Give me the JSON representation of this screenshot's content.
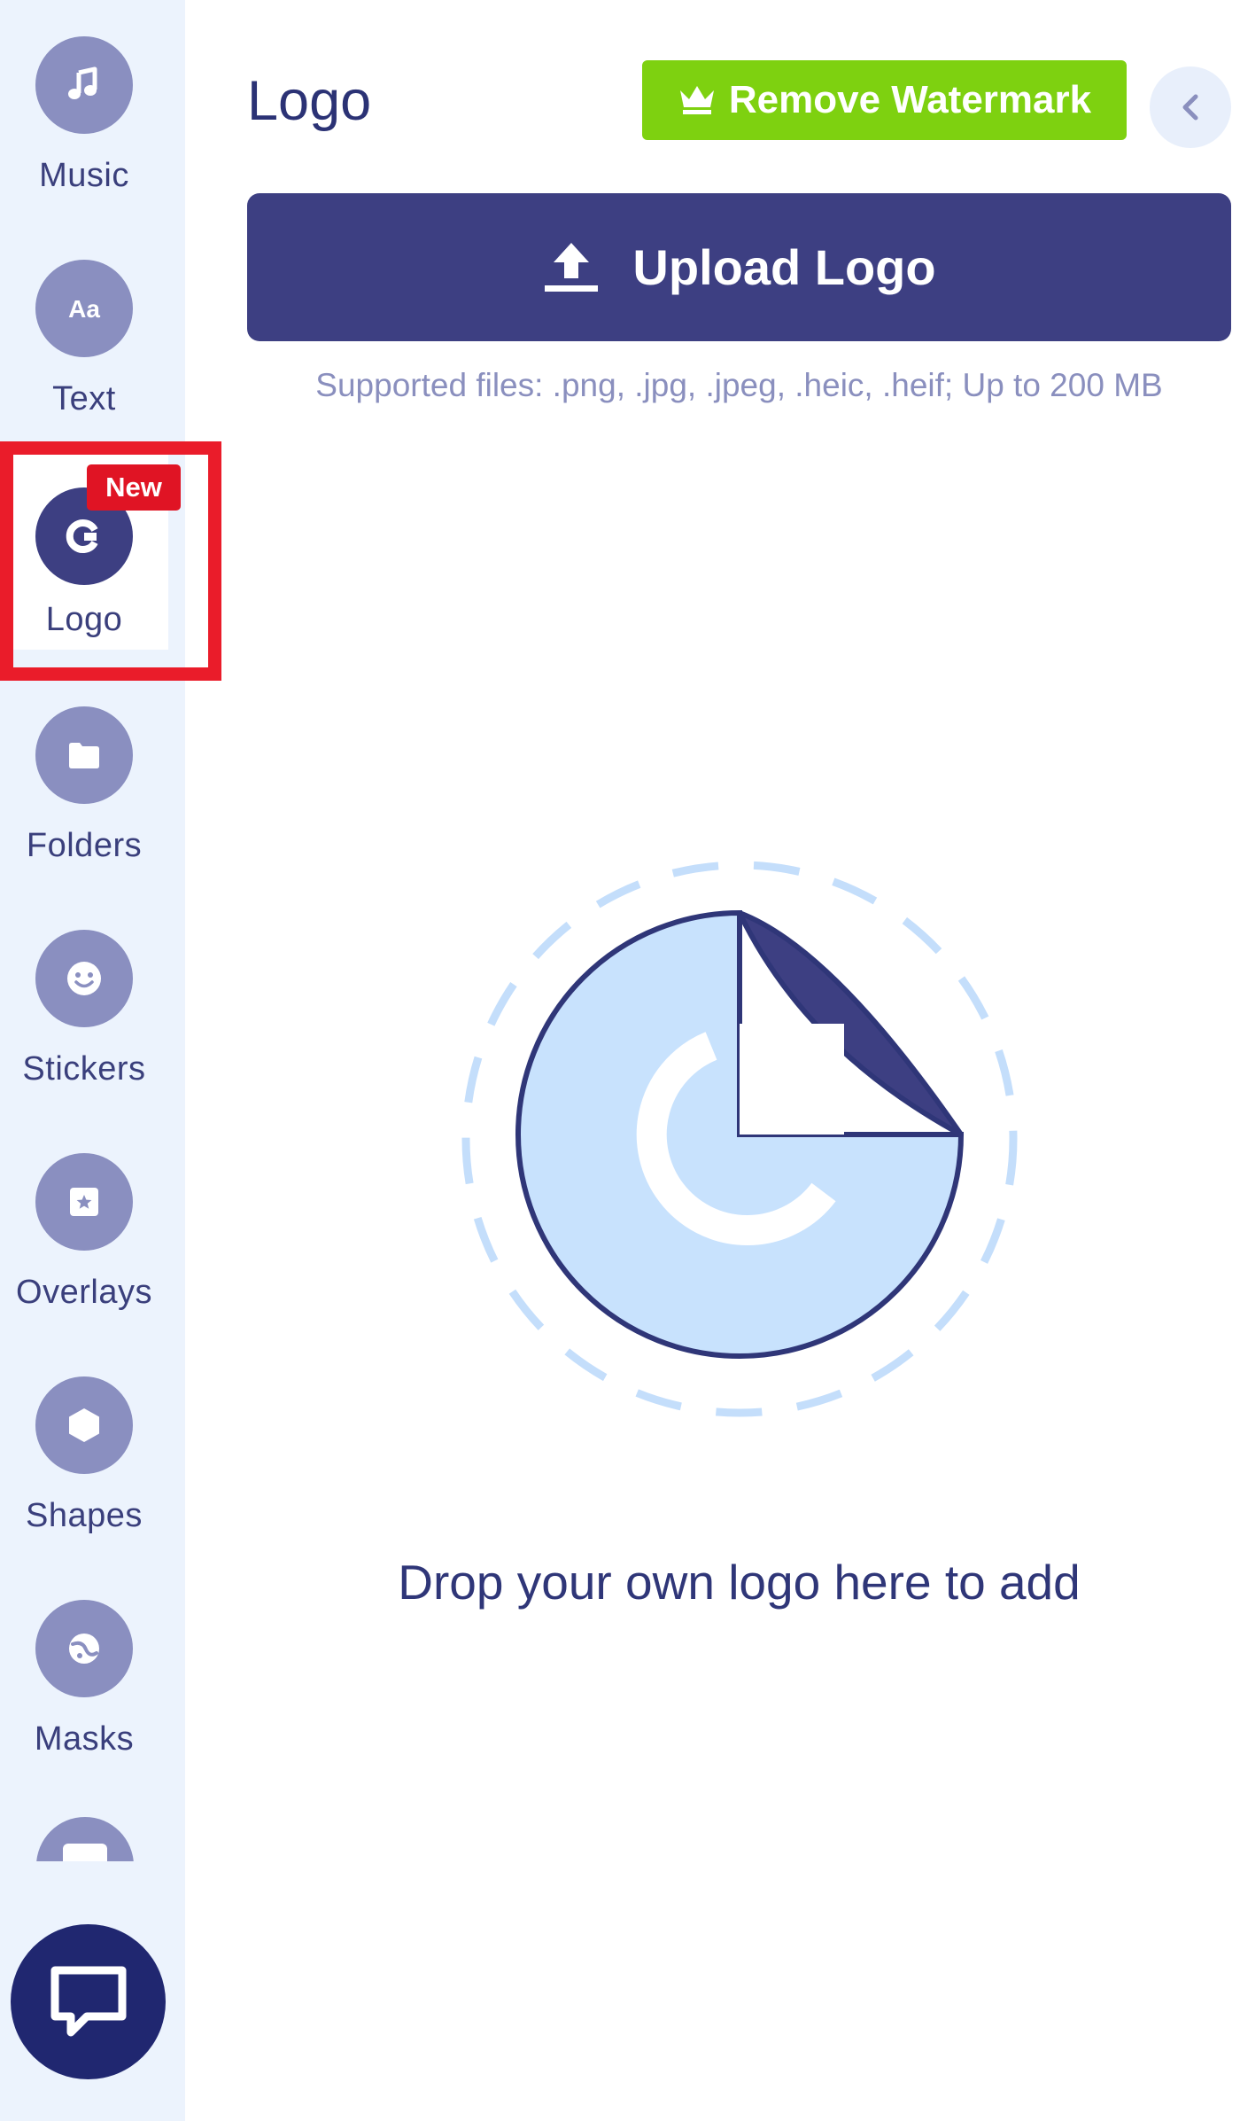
{
  "colors": {
    "sidebar_bg": "#ecf3fd",
    "nav_icon_bg": "#8a8fc0",
    "nav_icon_bg_active": "#3d3f82",
    "nav_label": "#3a3f7c",
    "primary": "#3d3f82",
    "accent_green": "#7ed110",
    "badge_red": "#e01424",
    "highlight_frame": "#ea1c2a",
    "chat_button": "#202770",
    "illustration_fill": "#c8e2fd",
    "illustration_dash": "#c4defb"
  },
  "sidebar": {
    "items": [
      {
        "label": "Music",
        "icon": "music-note-icon",
        "active": false
      },
      {
        "label": "Text",
        "icon": "text-aa-icon",
        "active": false
      },
      {
        "label": "Logo",
        "icon": "logo-g-icon",
        "active": true,
        "badge": "New"
      },
      {
        "label": "Folders",
        "icon": "folder-icon",
        "active": false
      },
      {
        "label": "Stickers",
        "icon": "smiley-icon",
        "active": false
      },
      {
        "label": "Overlays",
        "icon": "star-overlay-icon",
        "active": false
      },
      {
        "label": "Shapes",
        "icon": "hexagon-icon",
        "active": false
      },
      {
        "label": "Masks",
        "icon": "mask-icon",
        "active": false
      }
    ],
    "partial_item_icon": "layout-icon",
    "chat_icon": "chat-bubble-icon"
  },
  "panel": {
    "title": "Logo",
    "remove_watermark_label": "Remove Watermark",
    "remove_watermark_icon": "crown-icon",
    "collapse_icon": "chevron-left-icon",
    "upload_label": "Upload Logo",
    "upload_icon": "upload-arrow-icon",
    "supported_files": "Supported files: .png, .jpg, .jpeg, .heic, .heif; Up to 200 MB",
    "drop_text": "Drop your own logo here to add",
    "drop_icon": "logo-sticker-icon"
  }
}
